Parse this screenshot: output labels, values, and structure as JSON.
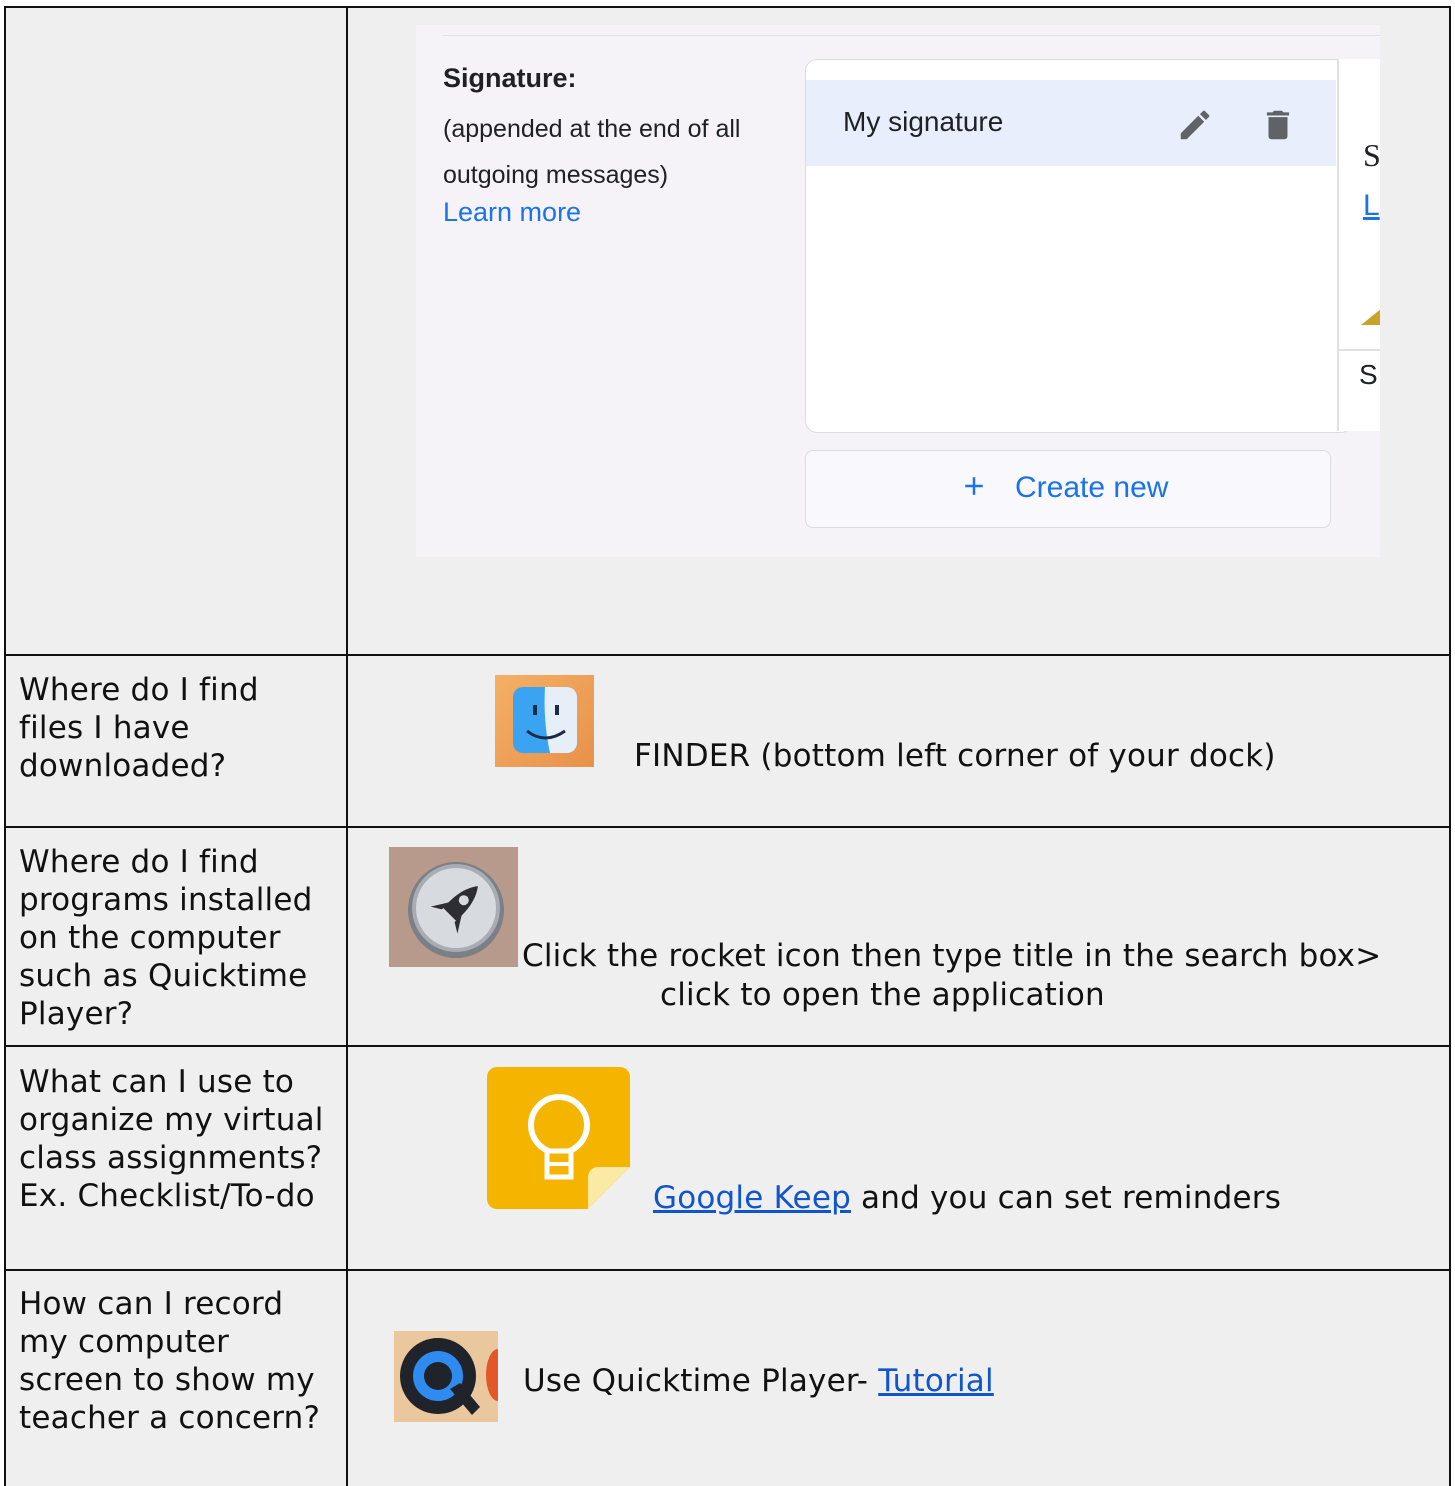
{
  "gmail": {
    "signature_label": "Signature:",
    "signature_description": "(appended at the end of all outgoing messages)",
    "learn_more": "Learn more",
    "signature_name": "My signature",
    "create_new": "Create new",
    "cut_letter_s": "S",
    "cut_letter_l": "L",
    "cut_letter_s2": "S"
  },
  "rows": [
    {
      "question": "Where do I find files I have downloaded?",
      "icon": "finder-icon",
      "answer": "FINDER (bottom left corner of your dock)"
    },
    {
      "question": "Where do I find programs installed on the computer such as Quicktime Player?",
      "icon": "launchpad-rocket-icon",
      "answer_line1": "Click the rocket icon then type title in the search box>",
      "answer_line2": "click to open the application"
    },
    {
      "question": "What can I use to organize my virtual class assignments? Ex. Checklist/To-do",
      "icon": "google-keep-icon",
      "answer_link": "Google Keep",
      "answer_rest": " and you can set reminders"
    },
    {
      "question": "How can I record my computer screen to show my teacher a concern?",
      "icon": "quicktime-icon",
      "answer_text": "Use Quicktime Player- ",
      "answer_link": "Tutorial"
    }
  ],
  "colors": {
    "cell_background": "#efefef",
    "border": "#111111",
    "link": "#1155cc",
    "gmail_blue": "#1a73e8"
  }
}
